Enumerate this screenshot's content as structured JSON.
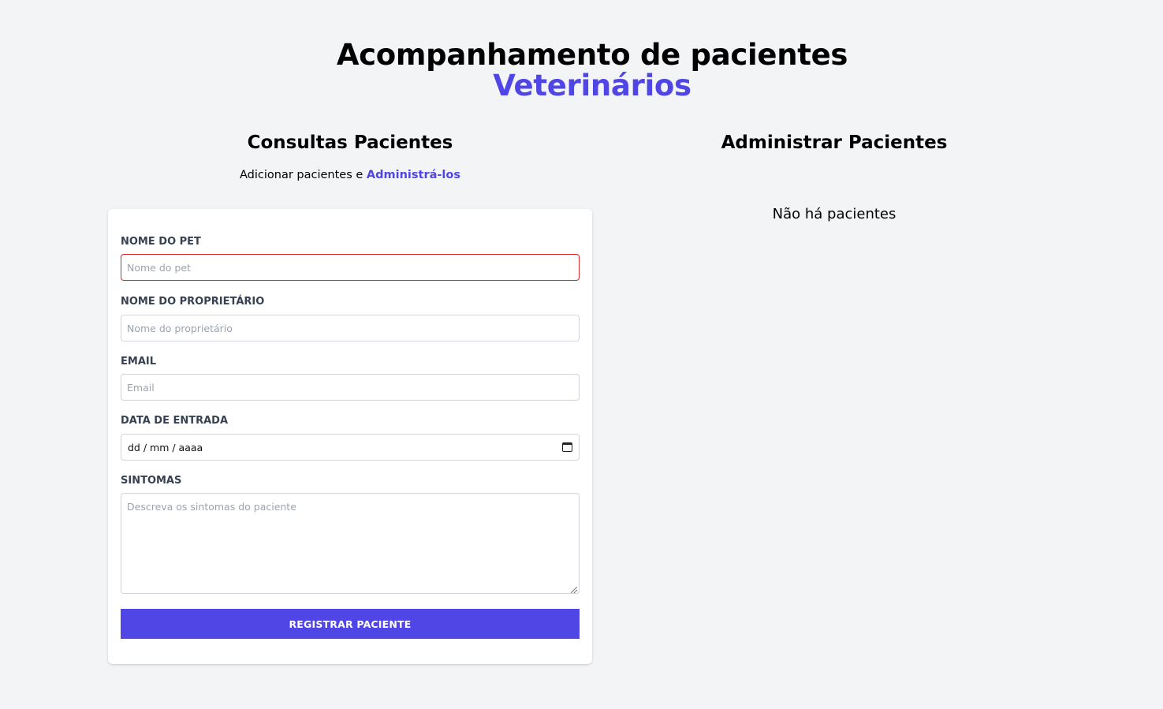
{
  "header": {
    "title": "Acompanhamento de pacientes",
    "title_accent": "Veterinários",
    "accent_color": "#4f46e5"
  },
  "form_section": {
    "title": "Consultas Pacientes",
    "subtitle_prefix": "Adicionar pacientes e ",
    "subtitle_link": "Administrá-los",
    "fields": {
      "pet_name": {
        "label": "NOME DO PET",
        "placeholder": "Nome do pet",
        "value": ""
      },
      "owner_name": {
        "label": "NOME DO PROPRIETÁRIO",
        "placeholder": "Nome do proprietário",
        "value": ""
      },
      "email": {
        "label": "EMAIL",
        "placeholder": "Email",
        "value": ""
      },
      "entry_date": {
        "label": "DATA DE ENTRADA",
        "display": "dd / mm / aaaa"
      },
      "symptoms": {
        "label": "SINTOMAS",
        "placeholder": "Descreva os sintomas do paciente",
        "value": ""
      }
    },
    "submit_label": "REGISTRAR PACIENTE"
  },
  "list_section": {
    "title": "Administrar Pacientes",
    "empty_message": "Não há pacientes"
  }
}
